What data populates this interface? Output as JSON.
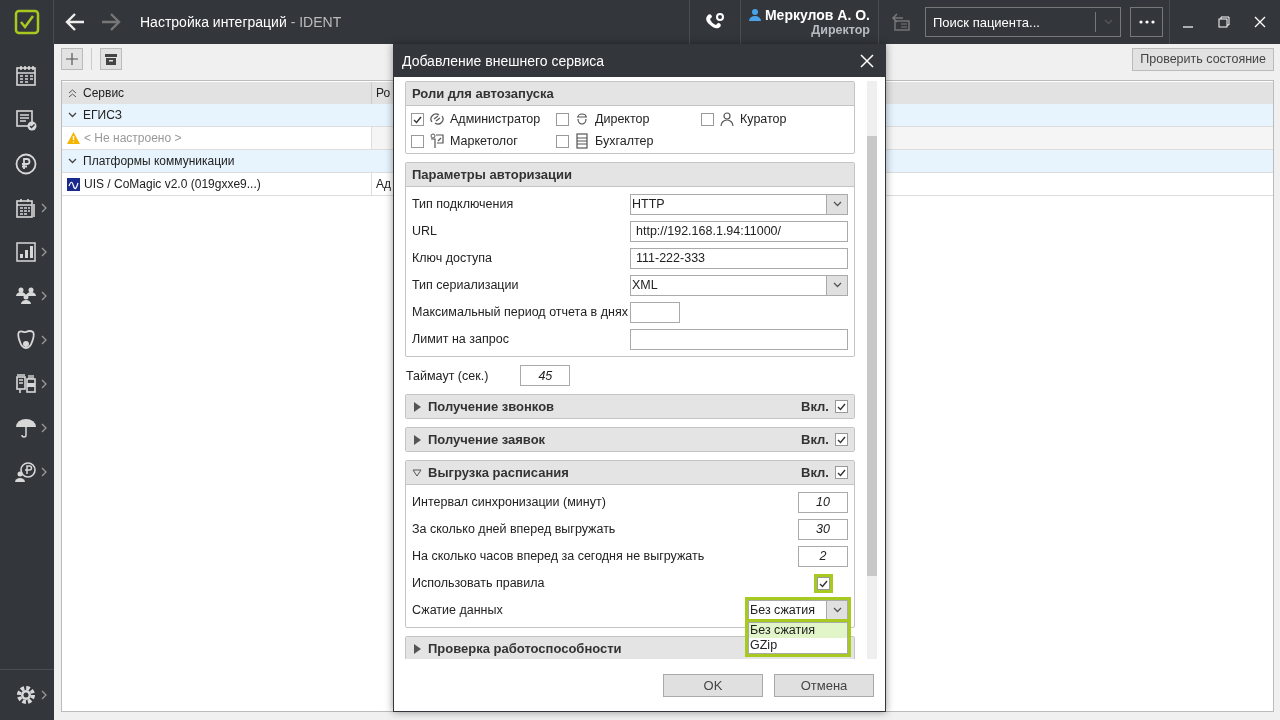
{
  "app": {
    "title": "Настройка интеграций",
    "subtitle": "- IDENT",
    "user_name": "Меркулов А. О.",
    "user_role": "Директор",
    "search": {
      "placeholder": "Поиск пациента..."
    }
  },
  "sidebar": {
    "items": [
      {
        "submenu": false
      },
      {
        "submenu": false
      },
      {
        "submenu": false
      },
      {
        "submenu": true
      },
      {
        "submenu": true
      },
      {
        "submenu": true
      },
      {
        "submenu": true
      },
      {
        "submenu": true
      },
      {
        "submenu": true
      },
      {
        "submenu": true
      }
    ],
    "settings": {
      "submenu": true
    }
  },
  "toolbar": {
    "check_button": "Проверить состояние"
  },
  "table": {
    "columns": [
      "Сервис",
      "Ро"
    ],
    "rows": [
      {
        "kind": "group",
        "label": "ЕГИСЗ",
        "expanded": true
      },
      {
        "kind": "warning",
        "cells": [
          "< Не настроено >"
        ]
      },
      {
        "kind": "group",
        "label": "Платформы коммуникации",
        "expanded": true
      },
      {
        "kind": "service",
        "cells": [
          "UIS / CoMagic v2.0 (019gxxe9...)",
          "Ад"
        ]
      }
    ]
  },
  "dialog": {
    "title": "Добавление внешнего сервиса",
    "roles": {
      "title": "Роли для автозапуска",
      "items": [
        {
          "label": "Администратор",
          "checked": true
        },
        {
          "label": "Директор",
          "checked": false
        },
        {
          "label": "Куратор",
          "checked": false
        },
        {
          "label": "Маркетолог",
          "checked": false
        },
        {
          "label": "Бухгалтер",
          "checked": false
        }
      ]
    },
    "auth": {
      "title": "Параметры авторизации",
      "fields": [
        {
          "kind": "select",
          "label": "Тип подключения",
          "value": "HTTP"
        },
        {
          "kind": "text",
          "label": "URL",
          "value": "http://192.168.1.94:11000/"
        },
        {
          "kind": "text",
          "label": "Ключ доступа",
          "value": "111-222-333"
        },
        {
          "kind": "select",
          "label": "Тип сериализации",
          "value": "XML"
        },
        {
          "kind": "short",
          "label": "Максимальный период отчета в днях"
        },
        {
          "kind": "text",
          "label": "Лимит на запрос"
        }
      ]
    },
    "timeout": {
      "label": "Таймаут (сек.)",
      "value": "45"
    },
    "sections": [
      {
        "title": "Получение звонков",
        "expanded": false,
        "toggle_label": "Вкл.",
        "enabled": true
      },
      {
        "title": "Получение заявок",
        "expanded": false,
        "toggle_label": "Вкл.",
        "enabled": true
      },
      {
        "title": "Выгрузка расписания",
        "expanded": true,
        "toggle_label": "Вкл.",
        "enabled": true,
        "fields": [
          {
            "kind": "number",
            "label": "Интервал синхронизации (минут)",
            "value": "10"
          },
          {
            "kind": "number",
            "label": "За сколько дней вперед выгружать",
            "value": "30"
          },
          {
            "kind": "number",
            "label": "На сколько часов вперед за сегодня не выгружать",
            "value": "2"
          },
          {
            "kind": "checkbox",
            "label": "Использовать правила",
            "checked": true,
            "highlighted": true
          },
          {
            "kind": "dropdown",
            "label": "Сжатие данных",
            "value": "Без сжатия",
            "highlighted": true,
            "options": [
              {
                "label": "Без сжатия",
                "selected": true
              },
              {
                "label": "GZip",
                "selected": false
              }
            ]
          }
        ]
      },
      {
        "title": "Проверка работоспособности",
        "expanded": false
      }
    ],
    "buttons": [
      "OK",
      "Отмена"
    ]
  }
}
